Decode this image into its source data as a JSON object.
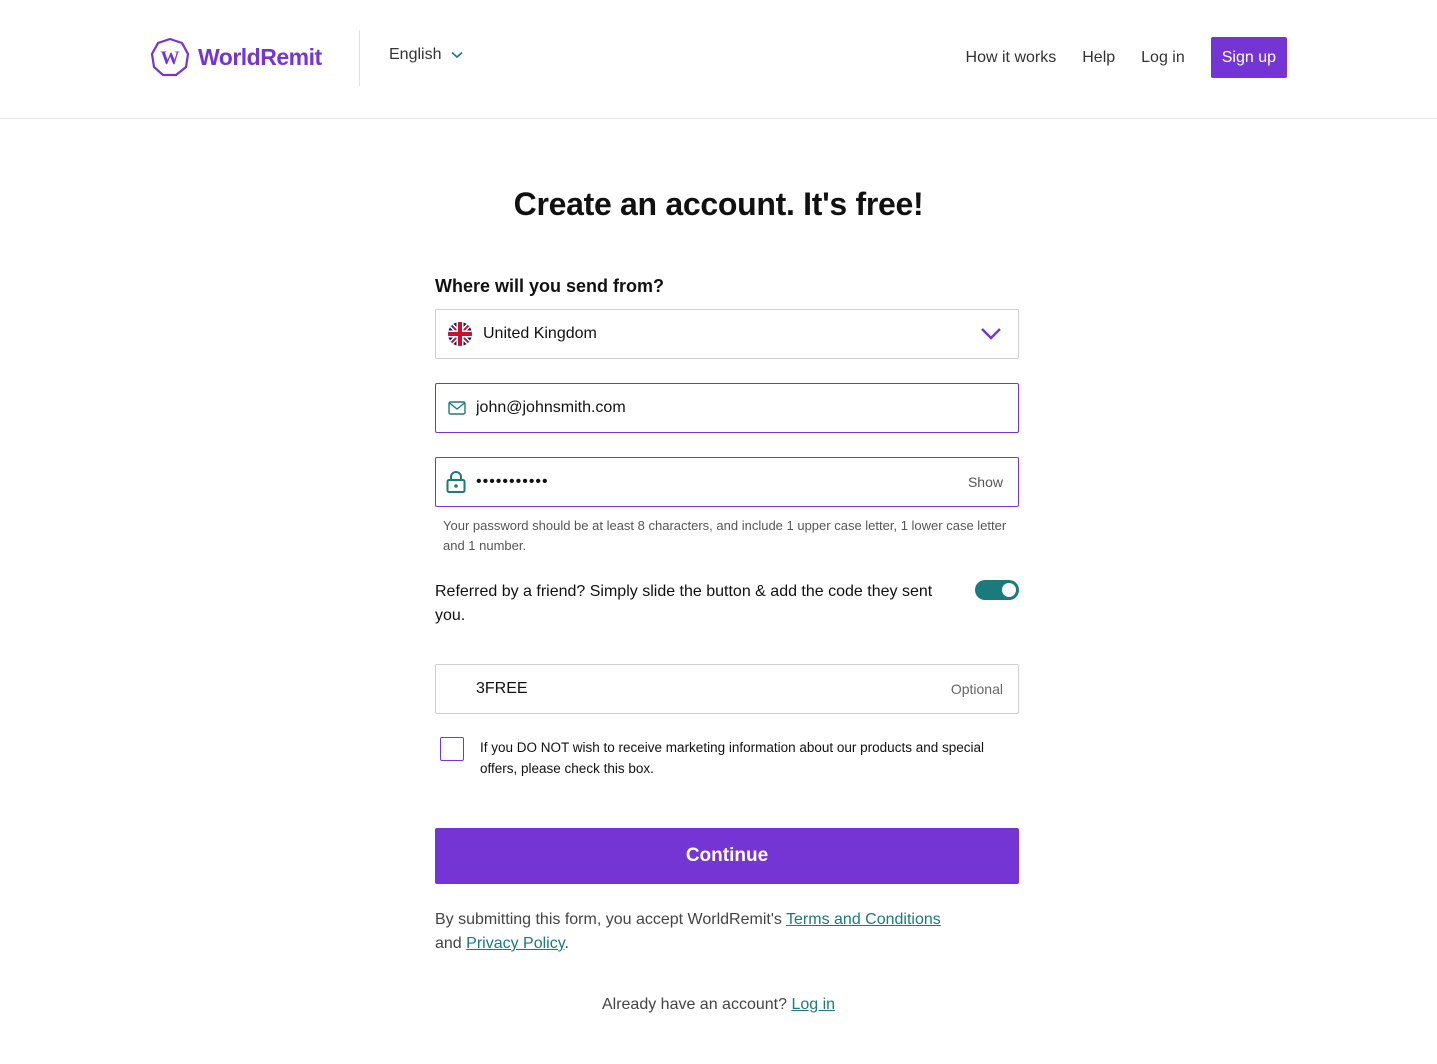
{
  "brand": {
    "name": "WorldRemit",
    "accent": "#7435d4",
    "teal": "#1a7a7c"
  },
  "header": {
    "language": "English",
    "nav": {
      "how_it_works": "How it works",
      "help": "Help",
      "log_in": "Log in",
      "sign_up": "Sign up"
    }
  },
  "main": {
    "title": "Create an account. It's free!",
    "send_from_label": "Where will you send from?",
    "country": {
      "value": "United Kingdom",
      "icon": "uk-flag-icon"
    },
    "email": {
      "value": "john@johnsmith.com",
      "icon": "mail-icon"
    },
    "password": {
      "masked_value": "•••••••••••",
      "show_label": "Show",
      "icon": "lock-icon",
      "hint": "Your password should be at least 8 characters, and include 1 upper case letter, 1 lower case letter and 1 number."
    },
    "referral": {
      "text": "Referred by a friend? Simply slide the button & add the code they sent you.",
      "toggle_on": true
    },
    "code": {
      "value": "3FREE",
      "optional_label": "Optional"
    },
    "marketing_opt_out": {
      "label": "If you DO NOT wish to receive marketing information about our products and special offers, please check this box.",
      "checked": false
    },
    "continue_label": "Continue",
    "terms": {
      "prefix": "By submitting this form, you accept WorldRemit's ",
      "terms_link": "Terms and Conditions",
      "middle": "and ",
      "privacy_link": "Privacy Policy",
      "suffix": "."
    },
    "already": {
      "text": "Already have an account? ",
      "login_link": "Log in"
    }
  }
}
